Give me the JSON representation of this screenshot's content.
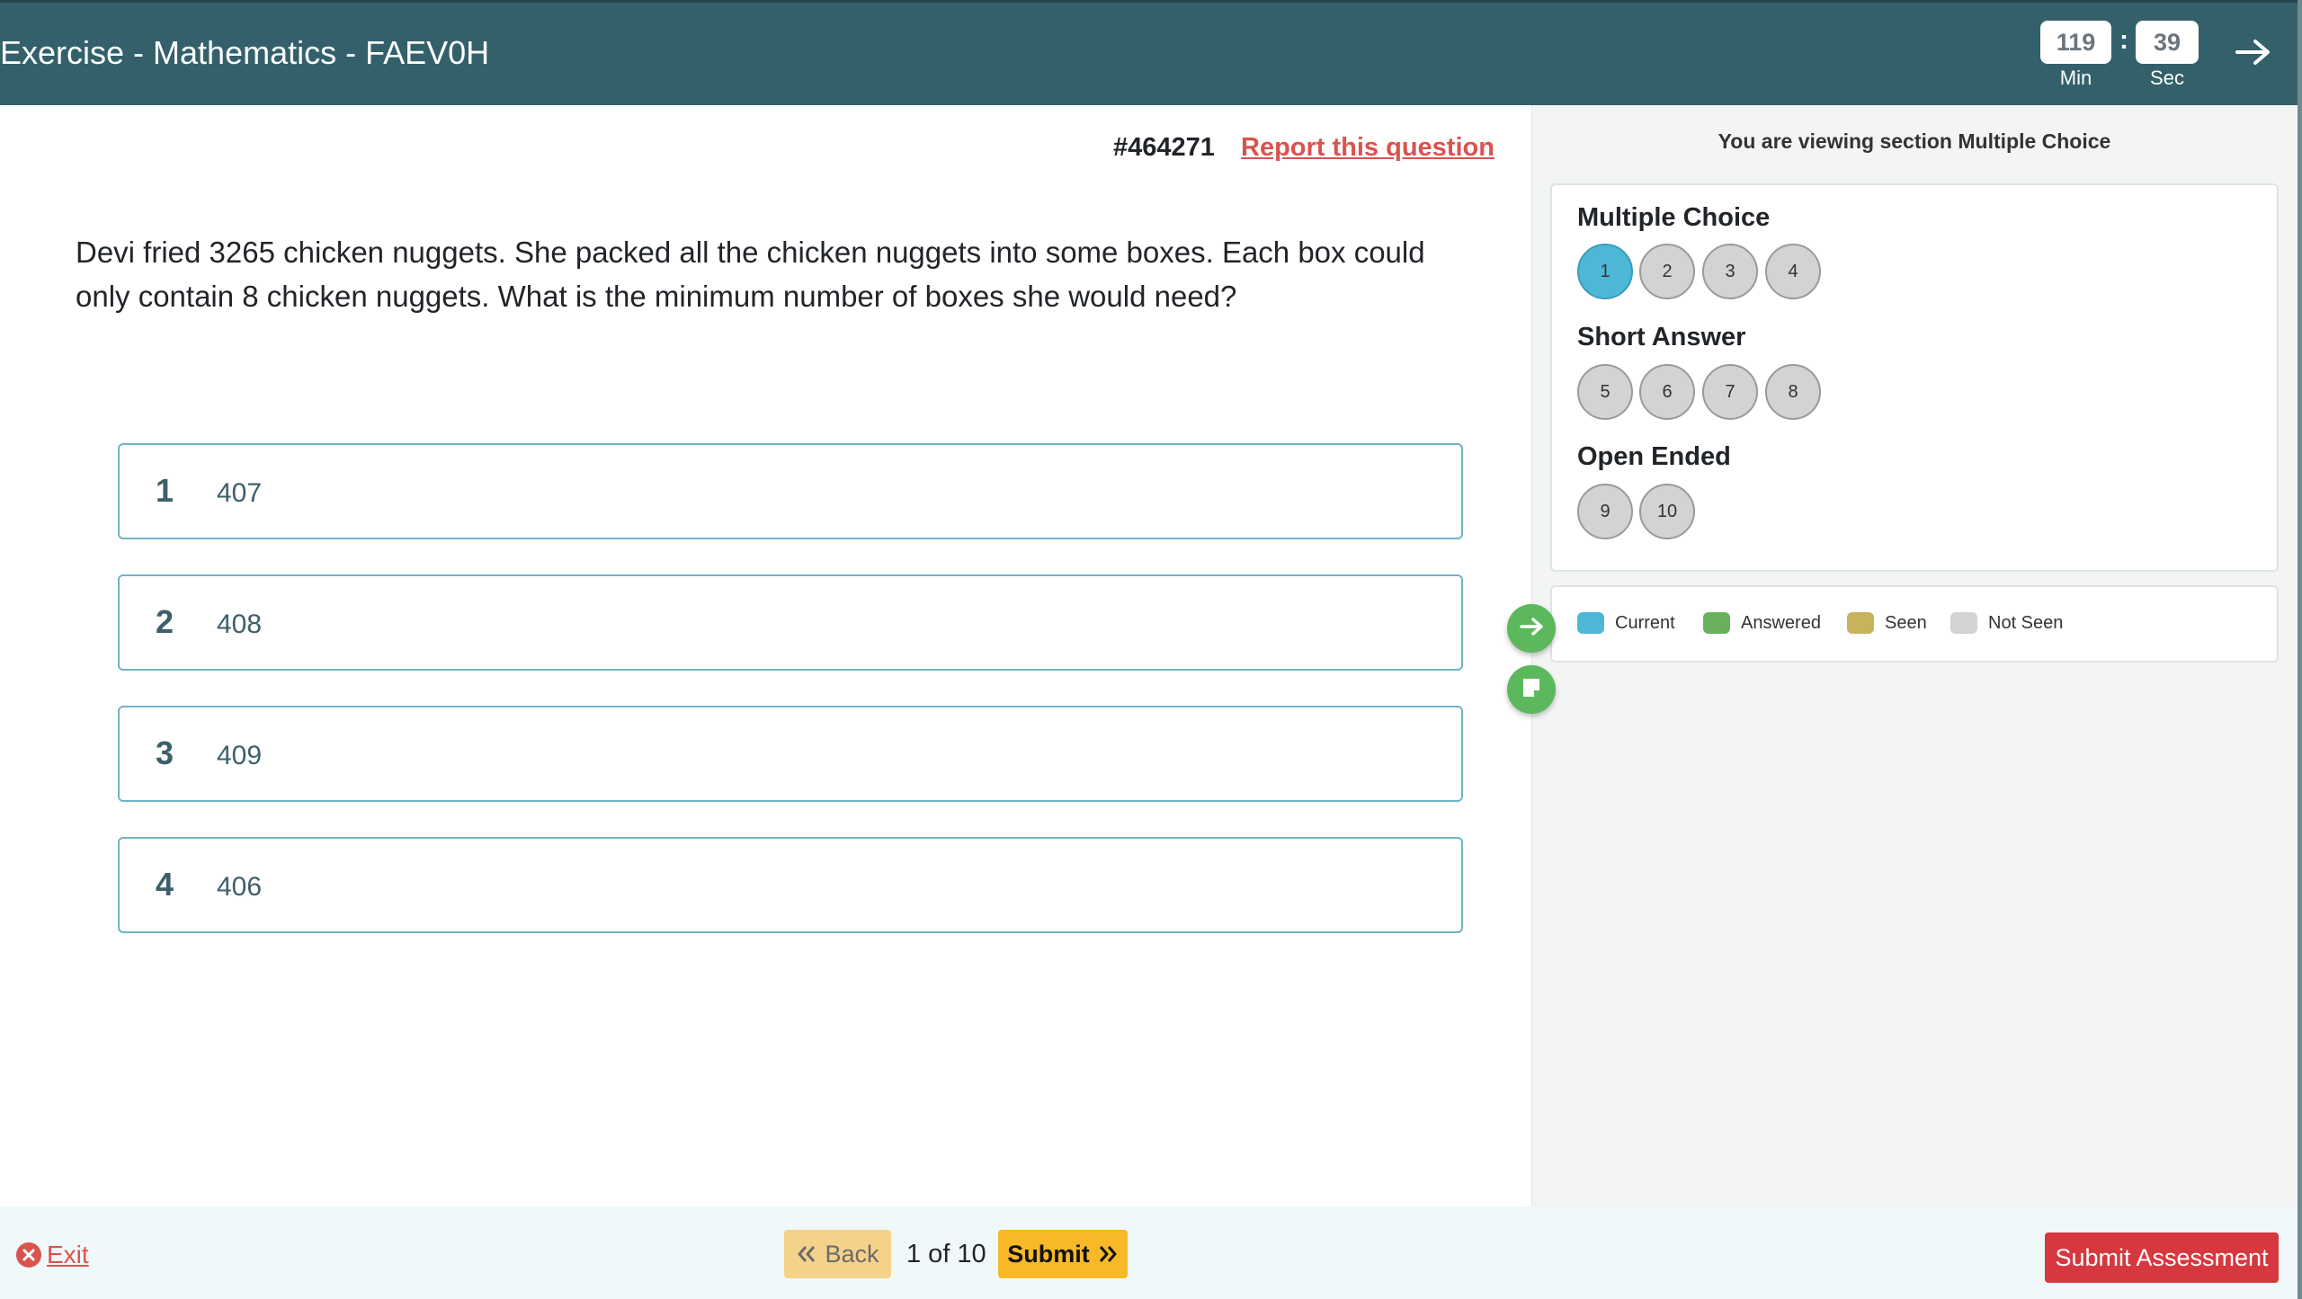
{
  "header": {
    "title": "Exercise - Mathematics - FAEV0H",
    "timer": {
      "minutes": "119",
      "seconds": "39",
      "separator": ":",
      "min_label": "Min",
      "sec_label": "Sec"
    },
    "next_icon": "arrow-right-icon"
  },
  "question": {
    "id": "#464271",
    "report_label": "Report this question",
    "text": "Devi fried 3265 chicken nuggets. She packed all the chicken nuggets into some boxes. Each box could only contain 8 chicken nuggets. What is the minimum number of boxes she would need?",
    "options": [
      {
        "number": "1",
        "value": "407"
      },
      {
        "number": "2",
        "value": "408"
      },
      {
        "number": "3",
        "value": "409"
      },
      {
        "number": "4",
        "value": "406"
      }
    ]
  },
  "side_panel": {
    "viewing_text": "You are viewing section Multiple Choice",
    "sections": [
      {
        "title": "Multiple Choice",
        "questions": [
          "1",
          "2",
          "3",
          "4"
        ]
      },
      {
        "title": "Short Answer",
        "questions": [
          "5",
          "6",
          "7",
          "8"
        ]
      },
      {
        "title": "Open Ended",
        "questions": [
          "9",
          "10"
        ]
      }
    ],
    "current_question": "1",
    "legend": [
      {
        "label": "Current",
        "color": "#4db8d6"
      },
      {
        "label": "Answered",
        "color": "#6aaf5e"
      },
      {
        "label": "Seen",
        "color": "#c9b25e"
      },
      {
        "label": "Not Seen",
        "color": "#d3d3d3"
      }
    ],
    "float_icons": [
      "arrow-right-icon",
      "note-icon"
    ]
  },
  "footer": {
    "exit_label": "Exit",
    "back_label": "Back",
    "page_indicator": "1 of 10",
    "submit_label": "Submit",
    "submit_assessment_label": "Submit Assessment"
  },
  "colors": {
    "header_bg": "#33606b",
    "accent_current": "#4db8d6",
    "danger": "#d9534f",
    "warning": "#f7b928"
  }
}
